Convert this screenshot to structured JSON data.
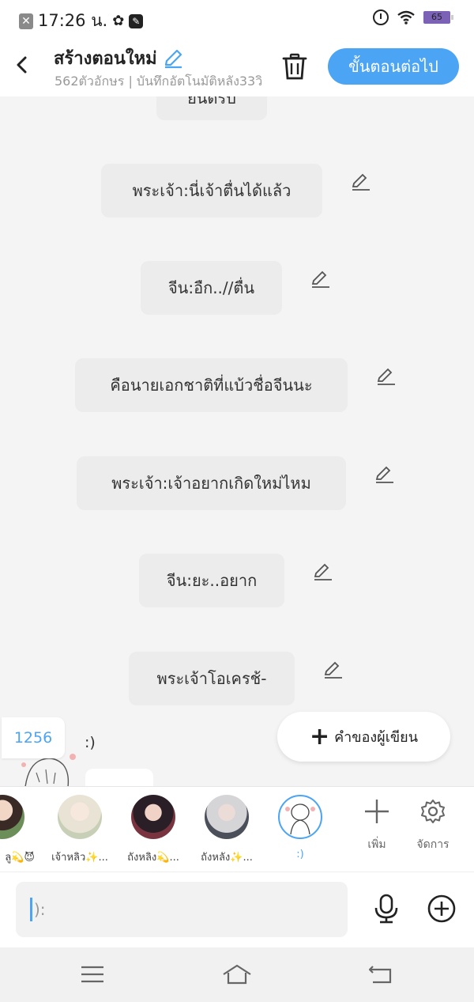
{
  "status_bar": {
    "time": "17:26 น.",
    "battery": "65"
  },
  "header": {
    "title": "สร้างตอนใหม่",
    "subtitle": "562ตัวอักษร | บันทึกอัตโนมัติหลัง33วิ",
    "next_button": "ขั้นตอนต่อไป"
  },
  "messages": [
    {
      "text": "ยินดีรับ",
      "partial": true
    },
    {
      "text": "พระเจ้า:นี่เจ้าตื่นได้แล้ว"
    },
    {
      "text": "จีน:อืก..//ตื่น"
    },
    {
      "text": "คือนายเอกชาติที่แบ้วชื่อจีนนะ"
    },
    {
      "text": "พระเจ้า:เจ้าอยากเกิดใหม่ไหม"
    },
    {
      "text": "จีน:ยะ..อยาก"
    },
    {
      "text": "พระเจ้าโอเครช้-"
    }
  ],
  "count_badge": "1256",
  "last_character_text": ":)",
  "author_note_button": "คำของผู้เขียน",
  "characters": [
    {
      "name": "ลู💫😈",
      "active": false
    },
    {
      "name": "เจ้าหลิว✨...",
      "active": false
    },
    {
      "name": "ถังหลิง💫...",
      "active": false
    },
    {
      "name": "ถังหลัง✨...",
      "active": false
    },
    {
      "name": ":)",
      "active": true
    }
  ],
  "strip_actions": {
    "add_label": "เพิ่ม",
    "manage_label": "จัดการ"
  },
  "input": {
    "placeholder": "):"
  },
  "colors": {
    "accent": "#4ca4f5",
    "bubble": "#ececec",
    "background": "#f4f4f4"
  }
}
